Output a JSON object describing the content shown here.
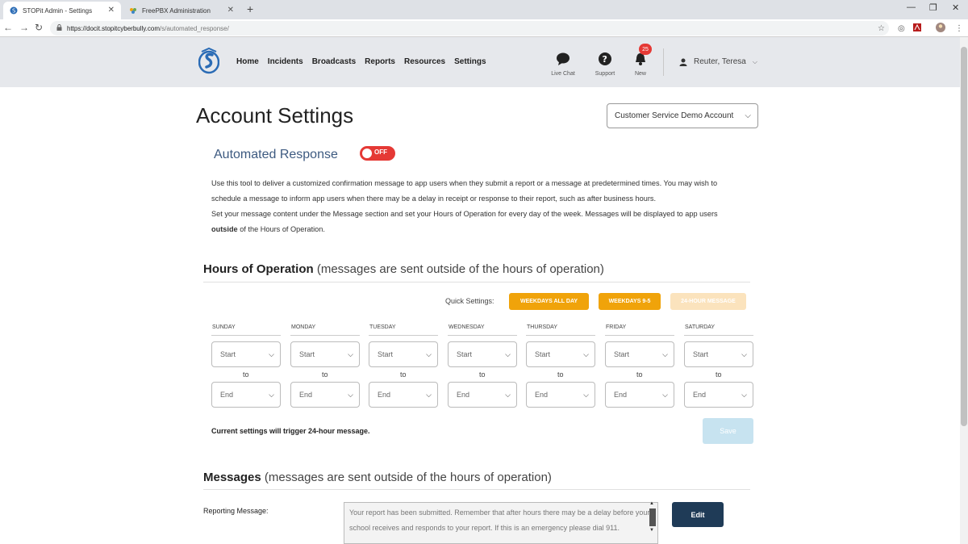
{
  "browser": {
    "tabs": [
      {
        "title": "STOPit Admin - Settings",
        "active": true
      },
      {
        "title": "FreePBX Administration",
        "active": false
      }
    ],
    "url_host": "https://docit.stopitcyberbully.com",
    "url_path": "/s/automated_response/"
  },
  "header": {
    "nav": [
      "Home",
      "Incidents",
      "Broadcasts",
      "Reports",
      "Resources",
      "Settings"
    ],
    "icons": [
      {
        "label": "Live Chat",
        "icon": "chat-icon"
      },
      {
        "label": "Support",
        "icon": "help-icon"
      },
      {
        "label": "New",
        "icon": "bell-icon"
      }
    ],
    "badge_count": "25",
    "user_name": "Reuter, Teresa"
  },
  "page": {
    "title": "Account Settings",
    "account_selected": "Customer Service Demo Account",
    "section_title": "Automated Response",
    "toggle_label": "OFF",
    "toggle_state": "off",
    "description_1": "Use this tool to deliver a customized confirmation message to app users when they submit a report or a message at predetermined times. You may wish to schedule a message to inform app users when there may be a delay in receipt or response to their report, such as after business hours.",
    "description_2_pre": "Set your message content under the Message section and set your Hours of Operation for every day of the week. Messages will be displayed to app users ",
    "description_2_bold": "outside",
    "description_2_post": " of the Hours of Operation."
  },
  "hours": {
    "title": "Hours of Operation",
    "subtitle": "(messages are sent outside of the hours of operation)",
    "quick_label": "Quick Settings:",
    "quick_buttons": [
      "WEEKDAYS ALL DAY",
      "WEEKDAYS 9-5",
      "24-HOUR MESSAGE"
    ],
    "quick_colors": [
      "#f0a30a",
      "#f0a30a",
      "#fbe3bd"
    ],
    "days": [
      "SUNDAY",
      "MONDAY",
      "TUESDAY",
      "WEDNESDAY",
      "THURSDAY",
      "FRIDAY",
      "SATURDAY"
    ],
    "start_placeholder": "Start",
    "end_placeholder": "End",
    "to_label": "to",
    "trigger_text": "Current settings will trigger 24-hour message.",
    "save_label": "Save"
  },
  "messages": {
    "title": "Messages",
    "subtitle": "(messages are sent outside of the hours of operation)",
    "reporting_label": "Reporting Message:",
    "reporting_text": "Your report has been submitted. Remember that after hours there may be a delay before your school receives and responds to your report. If this is an emergency please dial 911.",
    "edit_label": "Edit"
  }
}
